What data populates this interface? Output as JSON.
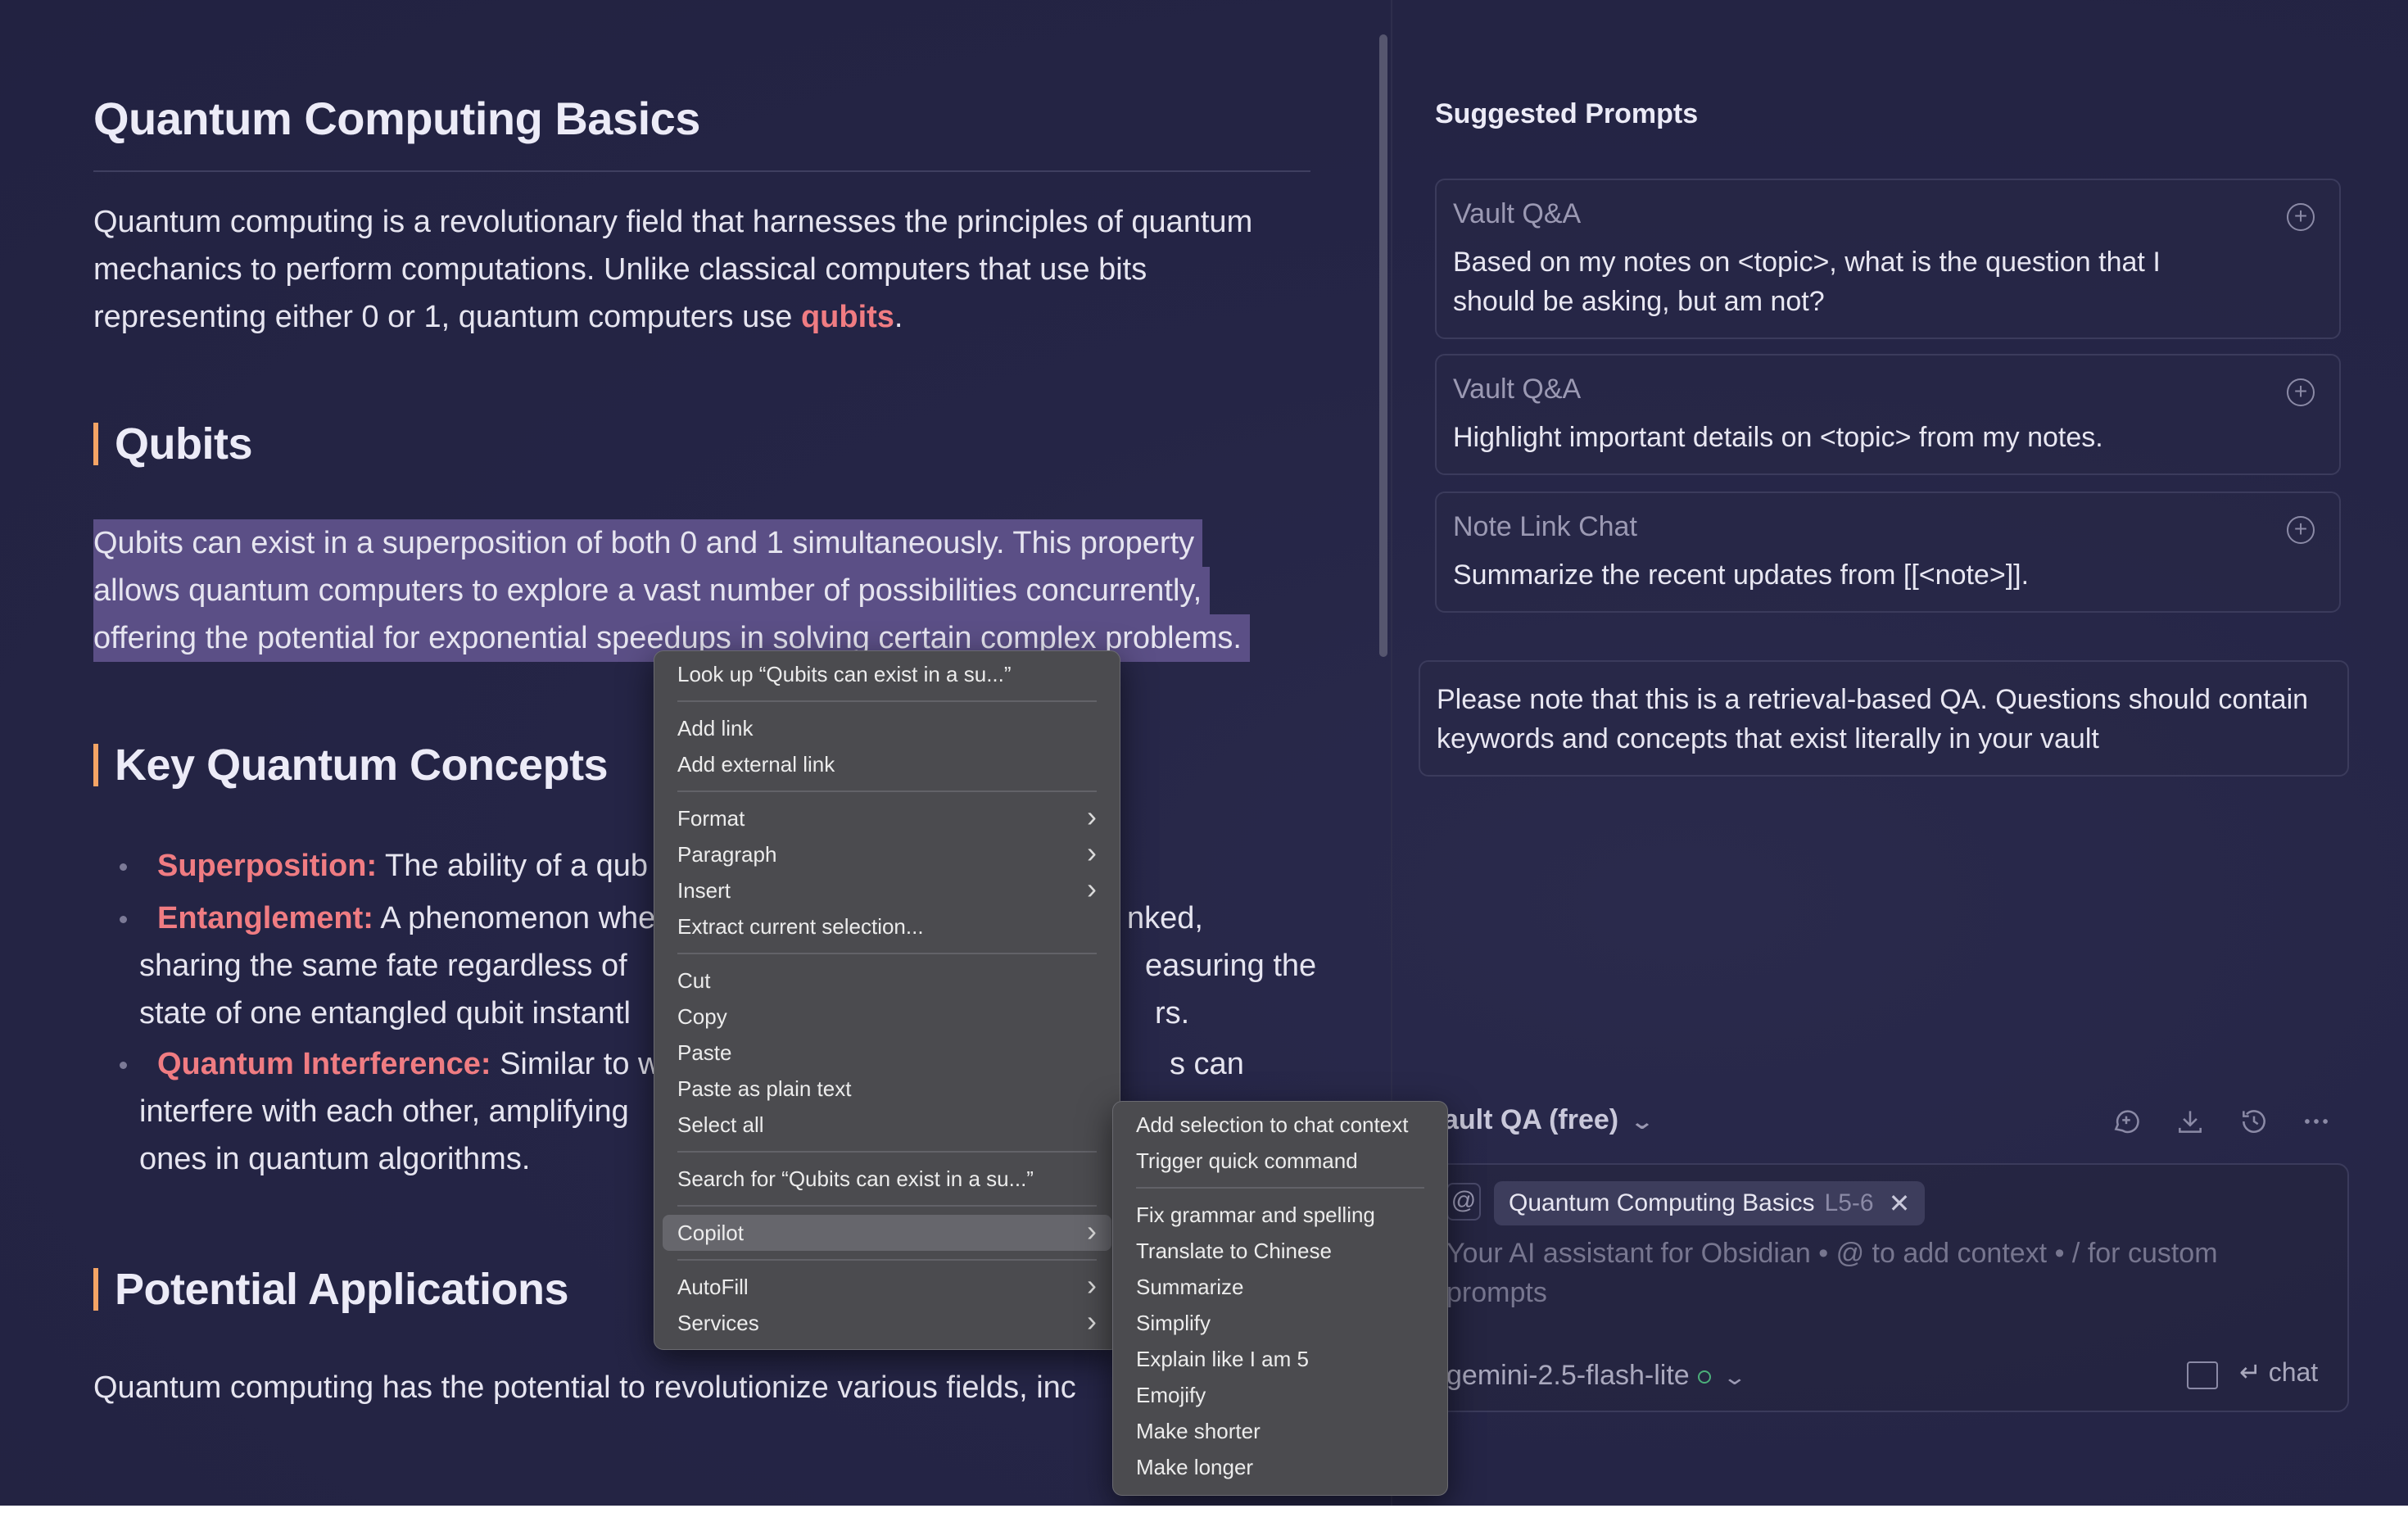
{
  "editor": {
    "title": "Quantum Computing Basics",
    "intro": {
      "text": "Quantum computing is a revolutionary field that harnesses the principles of quantum mechanics to perform computations. Unlike classical computers that use bits representing either 0 or 1, quantum computers use ",
      "link": "qubits",
      "end": "."
    },
    "qubits_heading": "Qubits",
    "qubits_lines": [
      "Qubits can exist in a superposition of both 0 and 1 simultaneously. This property",
      "allows quantum computers to explore a vast number of possibilities concurrently,",
      "offering the potential for exponential speedups in solving certain complex problems."
    ],
    "concepts_heading": "Key Quantum Concepts",
    "concepts": [
      {
        "term": "Superposition:",
        "visible_text": " The ability of a qub",
        "tail": "."
      },
      {
        "term": "Entanglement:",
        "visible_text": " A phenomenon whe",
        "tail": "nked,"
      },
      {
        "term": "Quantum Interference:",
        "visible_text": " Similar to w",
        "tail": "s can"
      }
    ],
    "concept_fragments": {
      "e_line2_start": "sharing the same fate regardless of",
      "e_line2_end": "easuring the",
      "e_line3_start": "state of one entangled qubit instantl",
      "e_line3_end": "rs.",
      "q_line2_start": "interfere with each other, amplifying",
      "q_line3": "ones in quantum algorithms."
    },
    "applications_heading": "Potential Applications",
    "applications_text": "Quantum computing has the potential to revolutionize various fields, inc"
  },
  "panel": {
    "title": "Suggested Prompts",
    "prompts": [
      {
        "type": "Vault Q&A",
        "text": "Based on my notes on <topic>, what is the question that I should be asking, but am not?"
      },
      {
        "type": "Vault Q&A",
        "text": "Highlight important details on <topic> from my notes."
      },
      {
        "type": "Note Link Chat",
        "text": "Summarize the recent updates from [[<note>]]."
      }
    ],
    "notice": "Please note that this is a retrieval-based QA. Questions should contain keywords and concepts that exist literally in your vault",
    "mode": "ault QA (free)",
    "context_chip": {
      "name": "Quantum Computing Basics",
      "range": "L5-6"
    },
    "input_placeholder": "Your AI assistant for Obsidian • @ to add context • / for custom prompts",
    "model": "gemini-2.5-flash-lite",
    "send_label": "chat",
    "icons": [
      "new-chat-icon",
      "download-icon",
      "history-icon",
      "more-icon"
    ]
  },
  "context_menu": {
    "items": {
      "lookup": "Look up “Qubits can exist in a su...”",
      "add_link": "Add link",
      "add_external_link": "Add external link",
      "format": "Format",
      "paragraph": "Paragraph",
      "insert": "Insert",
      "extract": "Extract current selection...",
      "cut": "Cut",
      "copy": "Copy",
      "paste": "Paste",
      "paste_plain": "Paste as plain text",
      "select_all": "Select all",
      "search_for": "Search for “Qubits can exist in a su...”",
      "copilot": "Copilot",
      "autofill": "AutoFill",
      "services": "Services"
    }
  },
  "copilot_submenu": {
    "items": {
      "add_selection": "Add selection to chat context",
      "trigger_quick": "Trigger quick command",
      "fix_grammar": "Fix grammar and spelling",
      "translate": "Translate to Chinese",
      "summarize": "Summarize",
      "simplify": "Simplify",
      "eli5": "Explain like I am 5",
      "emojify": "Emojify",
      "shorter": "Make shorter",
      "longer": "Make longer"
    }
  },
  "colors": {
    "background": "#252546",
    "accent_text": "#f07c82",
    "heading_bar": "#f4a465",
    "selection": "#5b4f86",
    "menu_bg": "#4b4b4f"
  }
}
